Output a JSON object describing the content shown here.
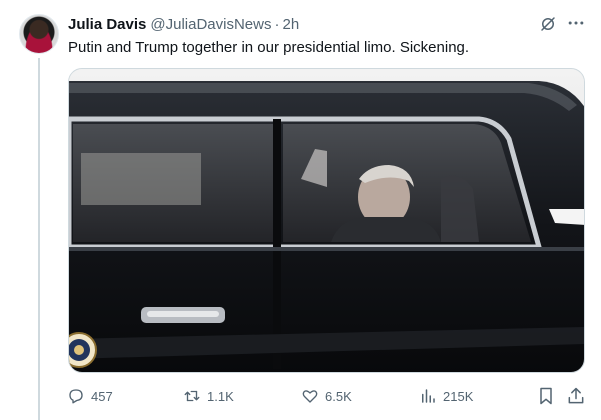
{
  "tweet": {
    "author": {
      "display_name": "Julia Davis",
      "handle": "@JuliaDavisNews",
      "separator": "·",
      "time": "2h"
    },
    "text": "Putin and Trump together in our presidential limo. Sickening.",
    "icons": {
      "grok": "grok-icon",
      "more": "more-icon"
    },
    "media": {
      "description_icon": "presidential-seal-icon"
    },
    "actions": {
      "replies": "457",
      "retweets": "1.1K",
      "likes": "6.5K",
      "views": "215K"
    }
  },
  "colors": {
    "text_primary": "#0f1419",
    "text_secondary": "#536471",
    "border": "#cfd9de"
  }
}
